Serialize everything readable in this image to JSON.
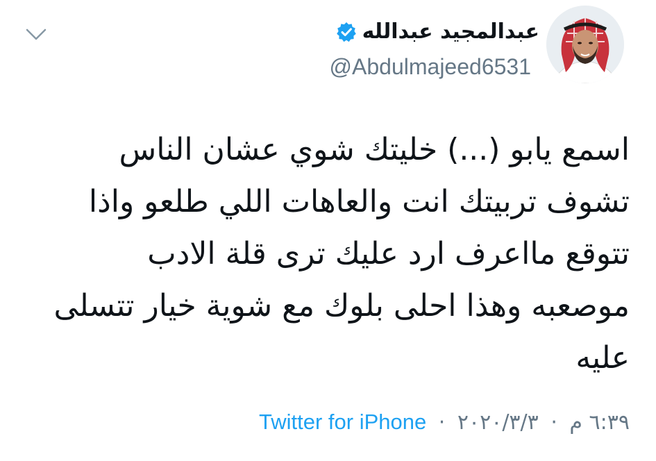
{
  "tweet": {
    "author": {
      "display_name": "عبدالمجيد عبدالله",
      "handle": "@Abdulmajeed6531",
      "verified": true,
      "avatar_icon": "profile-photo",
      "verified_icon": "verified-badge-icon"
    },
    "menu_icon": "chevron-down-icon",
    "text_lines": [
      "اسمع يابو (...) خليتك شوي عشان الناس",
      "تشوف تربيتك انت والعاهات اللي طلعو واذا",
      "تتوقع مااعرف ارد عليك ترى قلة الادب",
      "موصعبه وهذا احلى بلوك مع شوية خيار تتسلى",
      "عليه"
    ],
    "time": "٦:٣٩ م",
    "date": "٢٠٢٠/٣/٣",
    "source": "Twitter for iPhone",
    "separator": "·"
  },
  "colors": {
    "text": "#0f1419",
    "secondary": "#657786",
    "link": "#1da1f2",
    "verified": "#1da1f2"
  }
}
